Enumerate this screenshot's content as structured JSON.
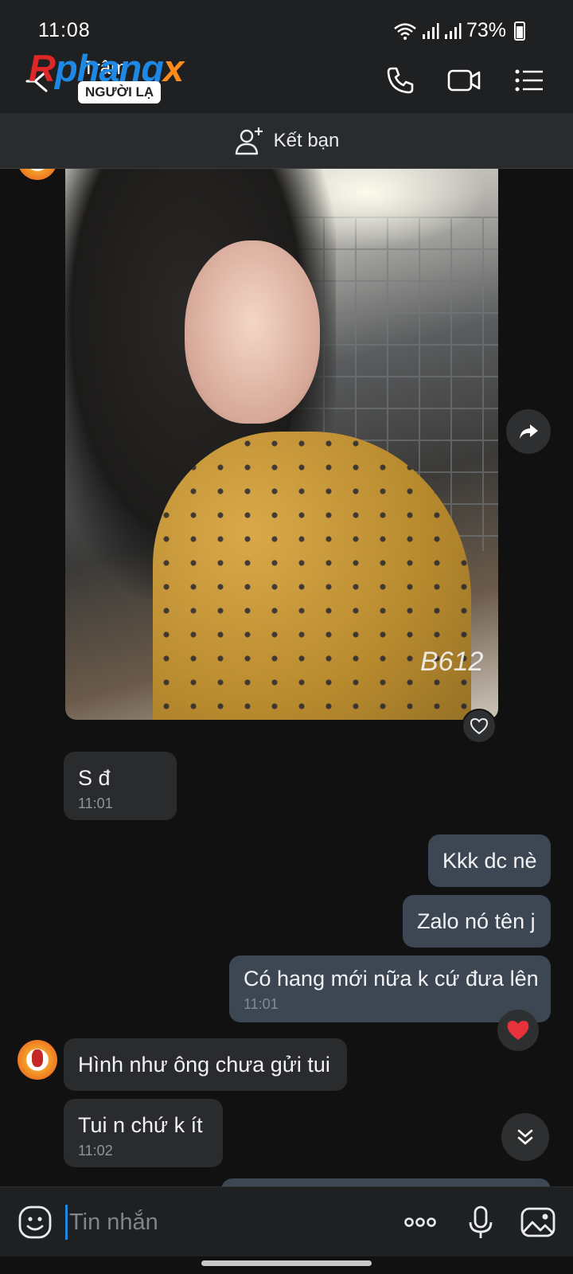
{
  "status_bar": {
    "time": "11:08",
    "battery_percent": "73%"
  },
  "header": {
    "logo": {
      "part1": "R",
      "part2": "phang",
      "part3": "x"
    },
    "contact_name": "Trâm",
    "badge": "NGƯỜI LẠ"
  },
  "add_friend": {
    "label": "Kết bạn"
  },
  "photo": {
    "watermark": "B612"
  },
  "messages": [
    {
      "text": "S đ",
      "time": "11:01"
    },
    {
      "text": "Kkk dc nè"
    },
    {
      "text": "Zalo nó tên j"
    },
    {
      "text": "Có hang mới nữa k cứ đưa lên",
      "time": "11:01"
    },
    {
      "text": "Hình như ông chưa gửi tui"
    },
    {
      "text": "Tui n chứ k ít",
      "time": "11:02"
    }
  ],
  "composer": {
    "placeholder": "Tin nhắn"
  },
  "colors": {
    "accent": "#1e88e5",
    "outgoing_bubble": "#3d4653",
    "incoming_bubble": "#2a2b2d",
    "reaction_heart": "#e8323b"
  }
}
